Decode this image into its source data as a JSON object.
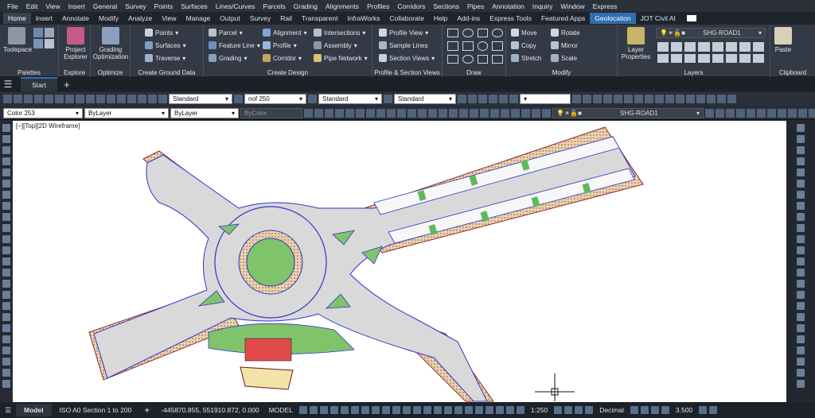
{
  "menu": [
    "File",
    "Edit",
    "View",
    "Insert",
    "General",
    "Survey",
    "Points",
    "Surfaces",
    "Lines/Curves",
    "Parcels",
    "Grading",
    "Alignments",
    "Profiles",
    "Corridors",
    "Sections",
    "Pipes",
    "Annotation",
    "Inquiry",
    "Window",
    "Express"
  ],
  "tabs": [
    "Home",
    "Insert",
    "Annotate",
    "Modify",
    "Analyze",
    "View",
    "Manage",
    "Output",
    "Survey",
    "Rail",
    "Transparent",
    "InfraWorks",
    "Collaborate",
    "Help",
    "Add-ins",
    "Express Tools",
    "Featured Apps",
    "Geolocation",
    "JOT Civil AI"
  ],
  "ribbon": {
    "palettes": {
      "toolspace": "Toolspace",
      "title": "Palettes"
    },
    "explore": {
      "btn1": "Project",
      "btn2": "Explorer",
      "title": "Explore"
    },
    "optimize": {
      "btn1": "Grading",
      "btn2": "Optimization",
      "title": "Optimize"
    },
    "ground": {
      "items": [
        "Points",
        "Surfaces",
        "Traverse"
      ],
      "title": "Create Ground Data"
    },
    "design": {
      "col1": [
        "Parcel",
        "Feature Line",
        "Grading"
      ],
      "col2": [
        "Alignment",
        "Profile",
        "Corridor"
      ],
      "col3": [
        "Intersections",
        "Assembly",
        "Pipe Network"
      ],
      "title": "Create Design"
    },
    "profsec": {
      "items": [
        "Profile View",
        "Sample Lines",
        "Section Views"
      ],
      "title": "Profile & Section Views"
    },
    "draw": {
      "title": "Draw"
    },
    "modify": {
      "col1": [
        "Move",
        "Copy",
        "Stretch"
      ],
      "col2": [
        "Rotate",
        "Mirror",
        "Scale"
      ],
      "title": "Modify"
    },
    "layers": {
      "btn1": "Layer",
      "btn2": "Properties",
      "current": "SHG-ROAD1",
      "title": "Layers"
    },
    "clipboard": {
      "paste": "Paste",
      "title": "Clipboard"
    }
  },
  "doc_tab": "Start",
  "toolbar1": {
    "style1": "Standard",
    "style2": "nof 250",
    "style3": "Standard",
    "style4": "Standard"
  },
  "toolbar2": {
    "color": "Color 253",
    "linetype": "ByLayer",
    "lineweight": "ByLayer",
    "plotstyle": "ByColor",
    "layer": "SHG-ROAD1"
  },
  "viewport_label": "[−][Top][2D Wireframe]",
  "status": {
    "model_tab": "Model",
    "layout_tab": "ISO A0 Section 1 to 200",
    "coords": "-445870.855, 551910.872, 0.000",
    "model": "MODEL",
    "scale": "1:250",
    "units": "Decimal",
    "lineweight": "3.500"
  }
}
